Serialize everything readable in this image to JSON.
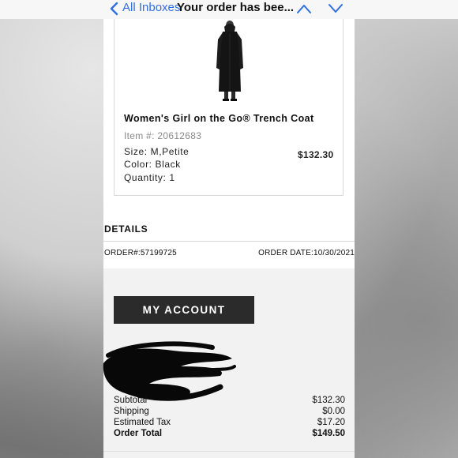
{
  "nav": {
    "back_label": "All Inboxes",
    "title": "Your order has bee..."
  },
  "product": {
    "name": "Women's Girl on the Go® Trench Coat",
    "item_number": "Item #: 20612683",
    "size": "Size: M,Petite",
    "color": "Color: Black",
    "quantity": "Quantity: 1",
    "price": "$132.30"
  },
  "details": {
    "heading": "DETAILS",
    "order_number": "ORDER#:57199725",
    "order_date": "ORDER DATE:10/30/2021"
  },
  "account": {
    "button_label": "MY ACCOUNT"
  },
  "totals": [
    {
      "label": "Subtotal",
      "value": "$132.30"
    },
    {
      "label": "Shipping",
      "value": "$0.00"
    },
    {
      "label": "Estimated Tax",
      "value": "$17.20"
    },
    {
      "label": "Order Total",
      "value": "$149.50"
    }
  ],
  "colors": {
    "link_blue": "#2f6fe0",
    "button_dark": "#2b2b2b",
    "panel_gray": "#f2f2f2"
  },
  "icons": {
    "back": "chevron-left-icon",
    "previous": "chevron-up-icon",
    "next": "chevron-down-icon"
  }
}
